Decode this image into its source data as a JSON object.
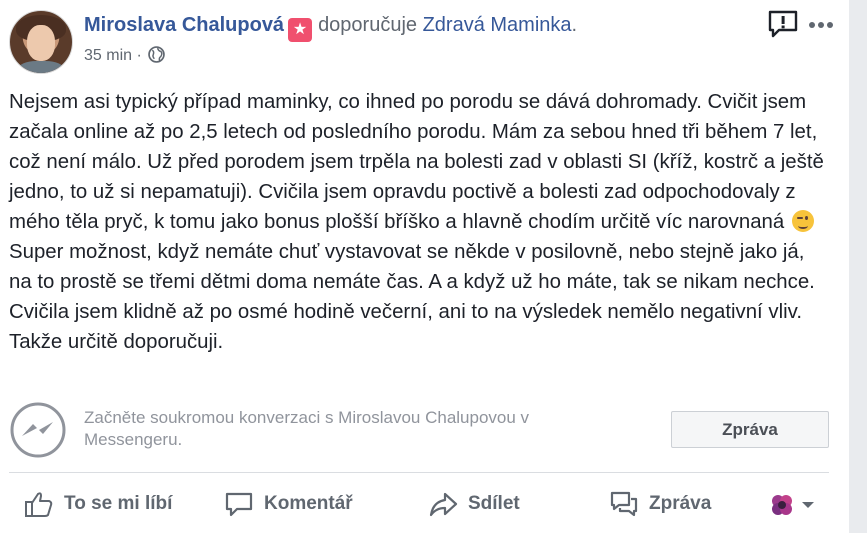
{
  "post": {
    "author": "Miroslava Chalupová",
    "badge_glyph": "★",
    "verb": "doporučuje",
    "page": "Zdravá Maminka",
    "page_suffix": ".",
    "time": "35 min",
    "dot": " · ",
    "text_part1": "Nejsem asi typický případ maminky, co ihned po porodu se dává dohromady. Cvičit jsem začala online až po 2,5 letech od posledního porodu. Mám za sebou hned tři během 7 let, což není málo. Už před porodem jsem trpěla na bolesti zad v oblasti SI (kříž, kostrč a ještě jedno, to už si nepamatuji). Cvičila jsem opravdu poctivě a bolesti zad odpochodovaly z mého těla pryč, k tomu jako bonus plošší bříško a hlavně chodím určitě víc narovnaná",
    "text_part2": " Super možnost, když nemáte chuť vystavovat se někde v posilovně, nebo stejně jako já, na to prostě se třemi dětmi doma nemáte čas. A a když už ho máte, tak se nikam nechce. Cvičila jsem klidně až po osmé hodině večerní, ani to na výsledek nemělo negativní vliv. Takže určitě doporučuji.",
    "emoji": "winking-face"
  },
  "messenger": {
    "prompt": "Začněte soukromou konverzaci s Miroslavou Chalupovou v Messengeru.",
    "button": "Zpráva"
  },
  "actions": {
    "like": "To se mi líbí",
    "comment": "Komentář",
    "share": "Sdílet",
    "message": "Zpráva"
  },
  "colors": {
    "link": "#365899",
    "muted": "#606770",
    "badge": "#f0506e"
  },
  "icons": [
    "avatar",
    "star-badge-icon",
    "globe-icon",
    "report-icon",
    "more-icon",
    "messenger-icon",
    "like-icon",
    "comment-icon",
    "share-icon",
    "message-icon",
    "reaction-icon",
    "chevron-down-icon"
  ]
}
